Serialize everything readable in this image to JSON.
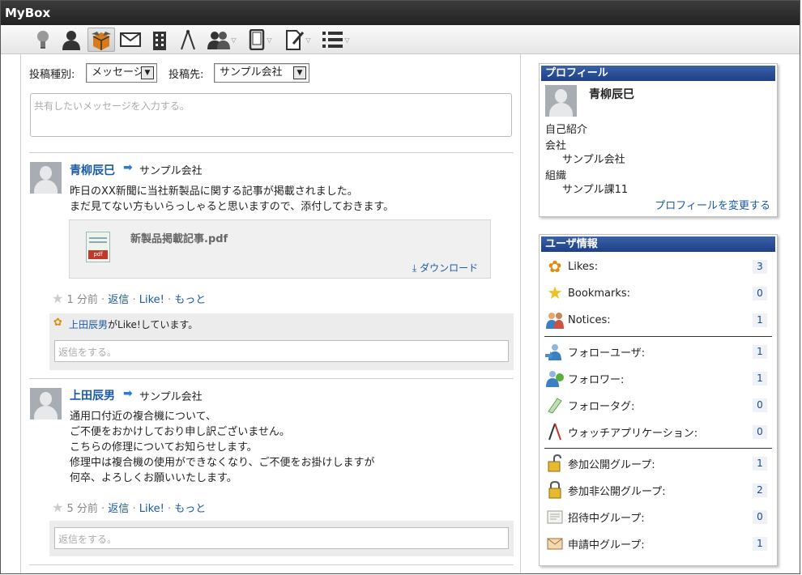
{
  "app": {
    "title": "MyBox"
  },
  "toolbar": {
    "icons": [
      "lightbulb-icon",
      "user-icon",
      "box-icon",
      "mail-icon",
      "building-icon",
      "compass-icon",
      "users-icon",
      "phone-icon",
      "edit-icon",
      "list-icon"
    ]
  },
  "composer": {
    "type_label": "投稿種別:",
    "type_value": "メッセージ",
    "dest_label": "投稿先:",
    "dest_value": "サンプル会社",
    "placeholder": "共有したいメッセージを入力する。"
  },
  "posts": [
    {
      "author": "青柳辰巳",
      "dest": "サンプル会社",
      "lines": [
        "昨日のXX新聞に当社新製品に関する記事が掲載されました。",
        "まだ見てない方もいらっしゃると思いますので、添付しておきます。"
      ],
      "attachment": {
        "filename": "新製品掲載記事.pdf",
        "download_label": "ダウンロード"
      },
      "time": "1 分前",
      "reply": "返信",
      "like": "Like!",
      "more": "もっと",
      "liked_by": "上田辰男",
      "liked_suffix": "がLike!しています。",
      "reply_placeholder": "返信をする。"
    },
    {
      "author": "上田辰男",
      "dest": "サンプル会社",
      "lines": [
        "通用口付近の複合機について、",
        "ご不便をおかけしており申し訳ございません。",
        "こちらの修理についてお知らせします。",
        "修理中は複合機の使用ができなくなり、ご不便をお掛けしますが",
        "何卒、よろしくお願いいたします。"
      ],
      "time": "5 分前",
      "reply": "返信",
      "like": "Like!",
      "more": "もっと",
      "reply_placeholder": "返信をする。"
    }
  ],
  "profile": {
    "header": "プロフィール",
    "name": "青柳辰巳",
    "intro_label": "自己紹介",
    "company_label": "会社",
    "company": "サンプル会社",
    "org_label": "組織",
    "org": "サンプル課11",
    "edit_link": "プロフィールを変更する"
  },
  "userinfo": {
    "header": "ユーザ情報",
    "rows": [
      {
        "label": "Likes:",
        "count": "3",
        "icon": "flower-icon"
      },
      {
        "label": "Bookmarks:",
        "count": "0",
        "icon": "star-icon"
      },
      {
        "label": "Notices:",
        "count": "1",
        "icon": "people-icon"
      },
      {
        "label": "フォローユーザ:",
        "count": "1",
        "icon": "follow-user-icon"
      },
      {
        "label": "フォロワー:",
        "count": "1",
        "icon": "follower-icon"
      },
      {
        "label": "フォロータグ:",
        "count": "0",
        "icon": "tag-icon"
      },
      {
        "label": "ウォッチアプリケーション:",
        "count": "0",
        "icon": "compass-icon"
      },
      {
        "label": "参加公開グループ:",
        "count": "1",
        "icon": "open-lock-icon"
      },
      {
        "label": "参加非公開グループ:",
        "count": "2",
        "icon": "lock-icon"
      },
      {
        "label": "招待中グループ:",
        "count": "0",
        "icon": "invite-icon"
      },
      {
        "label": "申請中グループ:",
        "count": "1",
        "icon": "envelope-icon"
      }
    ]
  }
}
